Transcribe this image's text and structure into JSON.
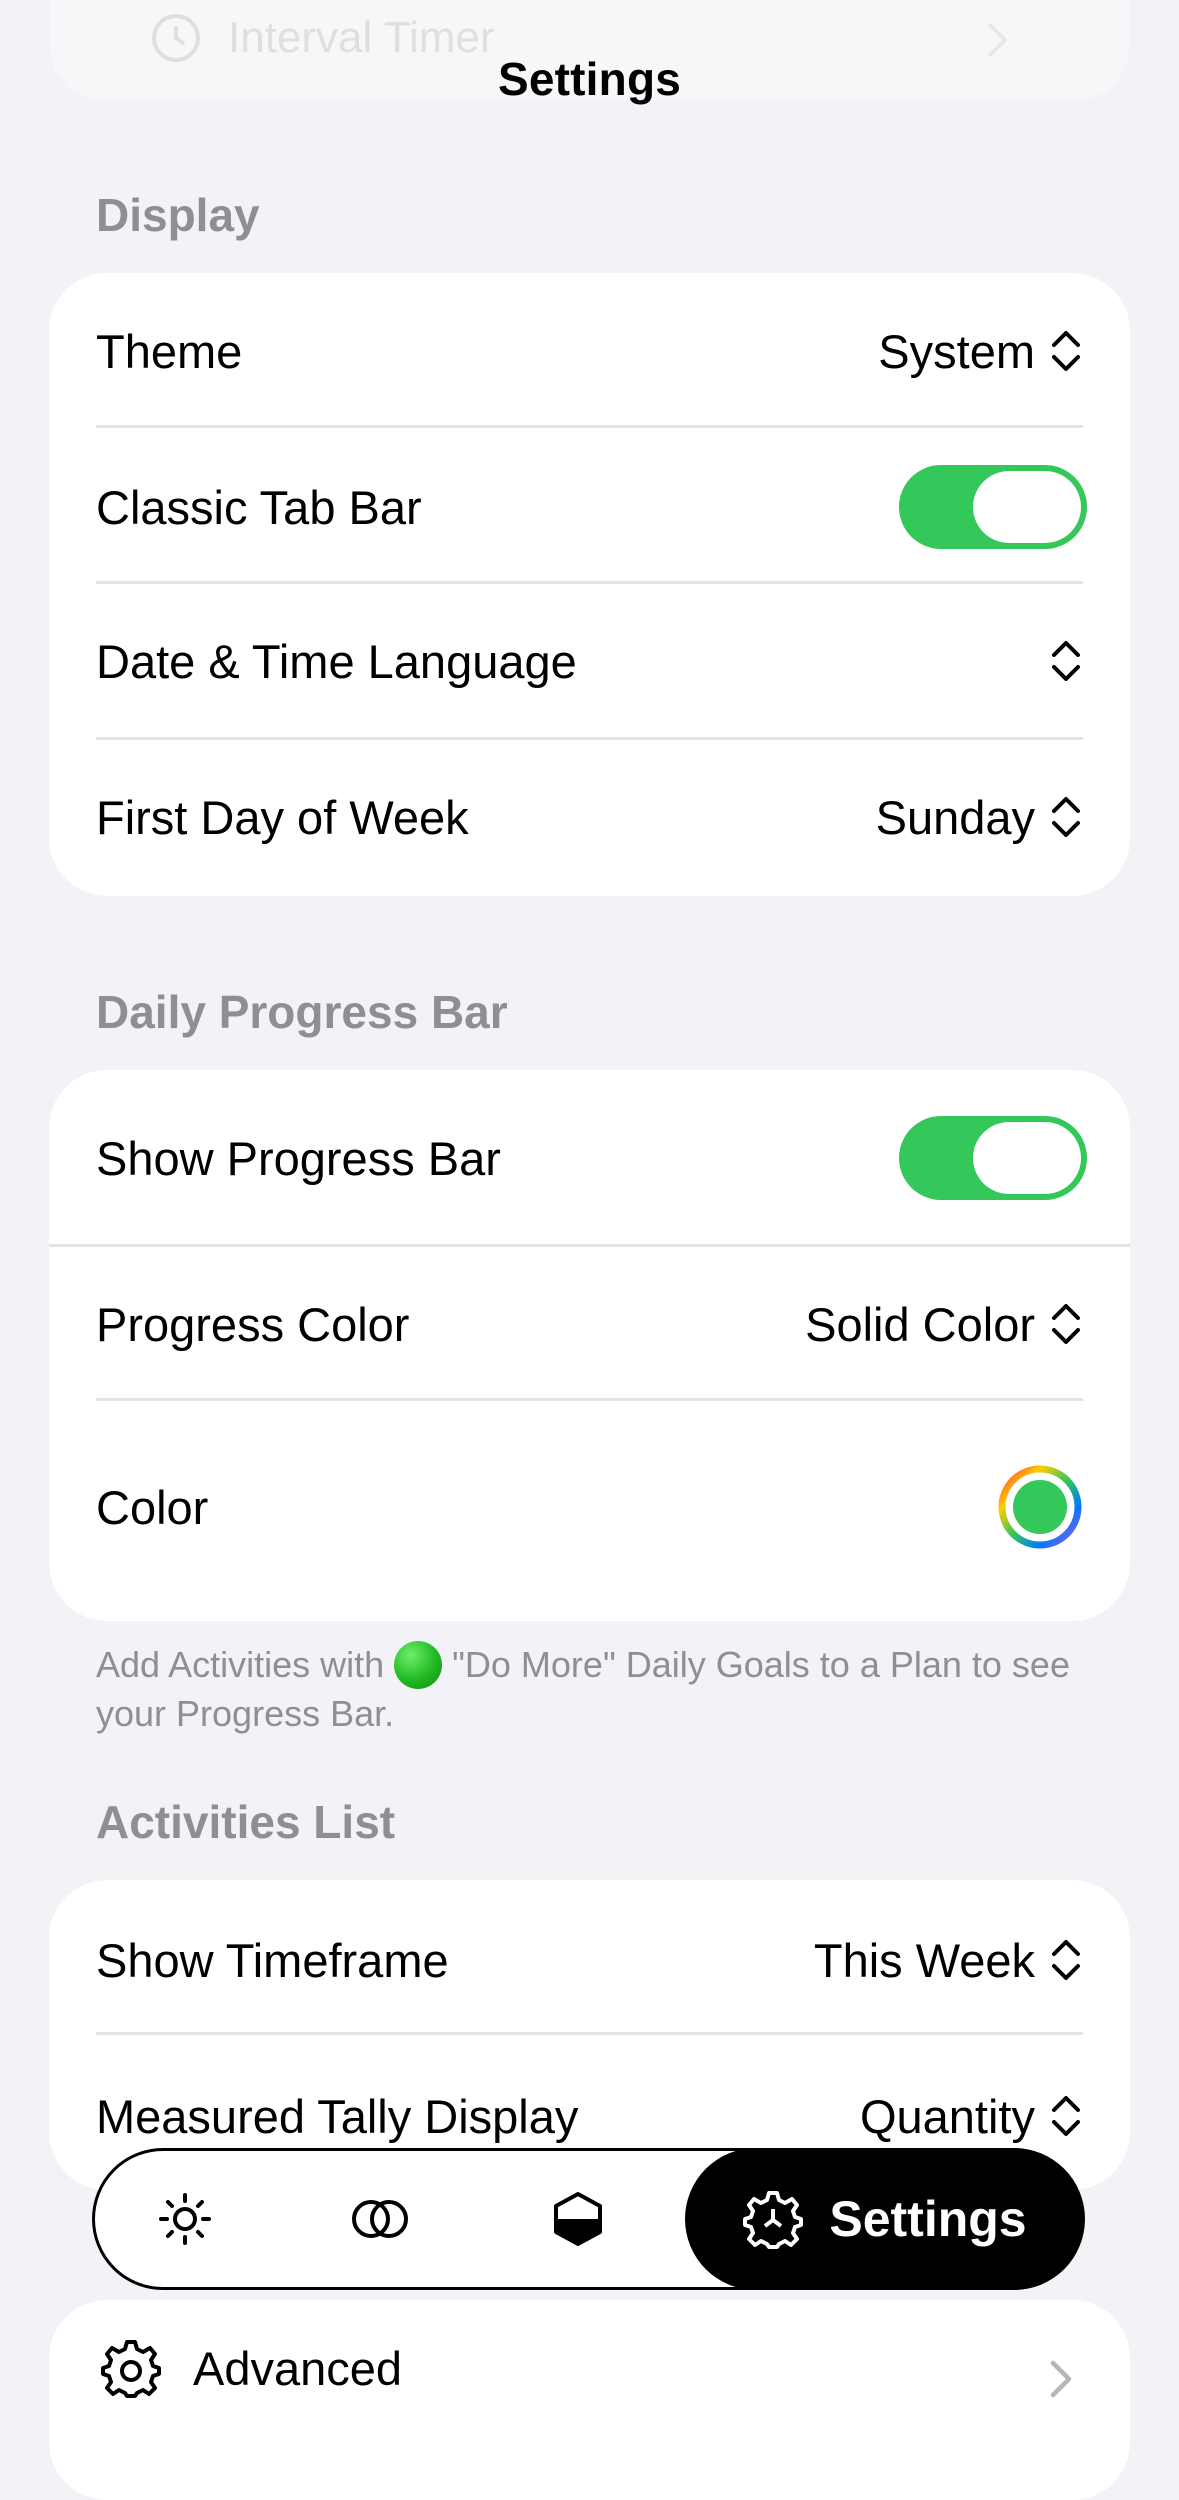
{
  "nav": {
    "title": "Settings"
  },
  "ghost": {
    "label": "Interval Timer"
  },
  "display": {
    "header": "Display",
    "theme": {
      "label": "Theme",
      "value": "System"
    },
    "classic_tab_bar": {
      "label": "Classic Tab Bar",
      "on": true
    },
    "date_time_language": {
      "label": "Date & Time Language",
      "value": ""
    },
    "first_day": {
      "label": "First Day of Week",
      "value": "Sunday"
    }
  },
  "progress": {
    "header": "Daily Progress Bar",
    "show_bar": {
      "label": "Show Progress Bar",
      "on": true
    },
    "progress_color": {
      "label": "Progress Color",
      "value": "Solid Color"
    },
    "color": {
      "label": "Color",
      "swatch": "#34c759"
    },
    "footnote_before": "Add Activities with",
    "footnote_after": "\"Do More\" Daily Goals to a Plan to see your Progress Bar."
  },
  "activities": {
    "header": "Activities List",
    "timeframe": {
      "label": "Show Timeframe",
      "value": "This Week"
    },
    "tally": {
      "label": "Measured Tally Display",
      "value": "Quantity"
    }
  },
  "tabbar": {
    "tabs": [
      {
        "icon": "sun-icon"
      },
      {
        "icon": "overlap-circles-icon"
      },
      {
        "icon": "hexagon-half-icon"
      },
      {
        "icon": "gear-icon",
        "label": "Settings",
        "active": true
      }
    ]
  },
  "advanced": {
    "label": "Advanced"
  },
  "colors": {
    "accent_green": "#34c759",
    "background": "#f2f2f7"
  }
}
